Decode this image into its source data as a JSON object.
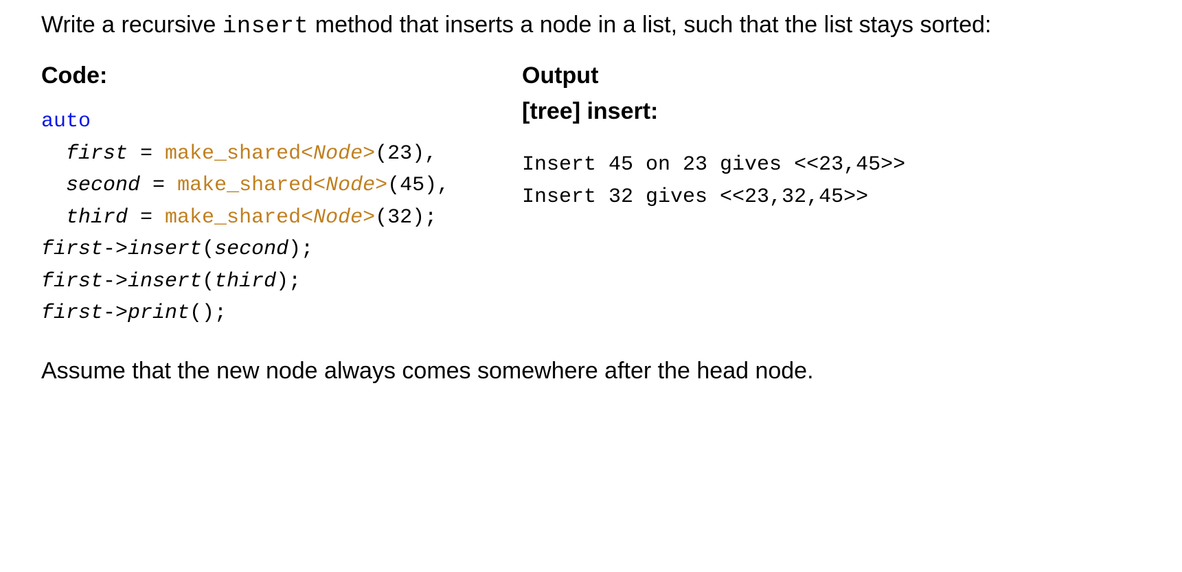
{
  "intro_part1": "Write a recursive ",
  "intro_code": "insert",
  "intro_part2": " method that inserts a node in a list, such that the list stays sorted:",
  "left": {
    "heading": "Code:",
    "code": {
      "kw_auto": "auto",
      "first_ident": "first",
      "eq": " = ",
      "ms_pre": "make_shared<",
      "node": "Node",
      "ms_post": ">",
      "arg_first": "(23),",
      "second_ident": "second",
      "arg_second": "(45),",
      "third_ident": "third",
      "arg_third": "(32);",
      "l5_a": "first",
      "l5_b": "->",
      "l5_c": "insert",
      "l5_d": "(",
      "l5_e": "second",
      "l5_f": ");",
      "l6_a": "first",
      "l6_b": "->",
      "l6_c": "insert",
      "l6_d": "(",
      "l6_e": "third",
      "l6_f": ");",
      "l7_a": "first",
      "l7_b": "->",
      "l7_c": "print",
      "l7_d": "();"
    }
  },
  "right": {
    "heading_l1": "Output",
    "heading_l2": "[tree] insert:",
    "out1": "Insert 45 on 23 gives <<23,45>>",
    "out2": "Insert 32 gives <<23,32,45>>"
  },
  "footer": "Assume that the new node always comes somewhere after the head node."
}
